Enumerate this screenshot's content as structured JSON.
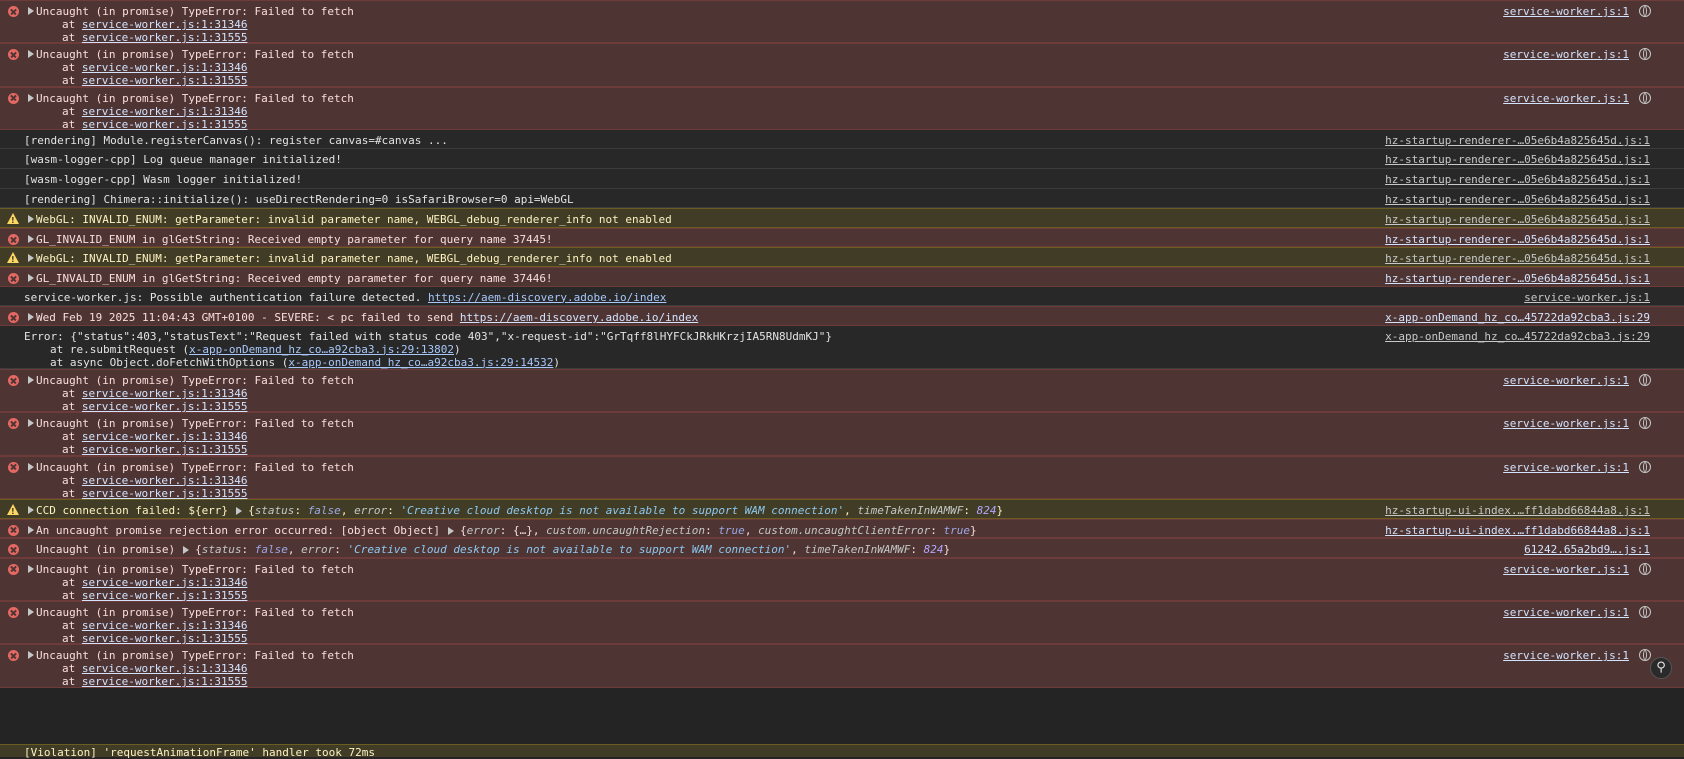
{
  "rows": [
    {
      "level": "error",
      "text": "Uncaught (in promise) TypeError: Failed to fetch",
      "stack": [
        "service-worker.js:1:31346",
        "service-worker.js:1:31555"
      ],
      "source": "service-worker.js:1"
    },
    {
      "level": "error",
      "text": "Uncaught (in promise) TypeError: Failed to fetch",
      "stack": [
        "service-worker.js:1:31346",
        "service-worker.js:1:31555"
      ],
      "source": "service-worker.js:1"
    },
    {
      "level": "error",
      "text": "Uncaught (in promise) TypeError: Failed to fetch",
      "stack": [
        "service-worker.js:1:31346",
        "service-worker.js:1:31555"
      ],
      "source": "service-worker.js:1"
    },
    {
      "level": "info",
      "text": "[rendering] Module.registerCanvas(): register canvas=#canvas ...",
      "source": "hz-startup-renderer-…05e6b4a825645d.js:1"
    },
    {
      "level": "info",
      "text": "[wasm-logger-cpp] Log queue manager initialized!",
      "source": "hz-startup-renderer-…05e6b4a825645d.js:1"
    },
    {
      "level": "info",
      "text": "[wasm-logger-cpp] Wasm logger initialized!",
      "source": "hz-startup-renderer-…05e6b4a825645d.js:1"
    },
    {
      "level": "info",
      "text": "[rendering] Chimera::initialize(): useDirectRendering=0 isSafariBrowser=0 api=WebGL",
      "source": "hz-startup-renderer-…05e6b4a825645d.js:1"
    },
    {
      "level": "warning",
      "text": "WebGL: INVALID_ENUM: getParameter: invalid parameter name, WEBGL_debug_renderer_info not enabled",
      "source": "hz-startup-renderer-…05e6b4a825645d.js:1"
    },
    {
      "level": "error",
      "text": "GL_INVALID_ENUM in glGetString: Received empty parameter for query name 37445!",
      "source": "hz-startup-renderer-…05e6b4a825645d.js:1"
    },
    {
      "level": "warning",
      "text": "WebGL: INVALID_ENUM: getParameter: invalid parameter name, WEBGL_debug_renderer_info not enabled",
      "source": "hz-startup-renderer-…05e6b4a825645d.js:1"
    },
    {
      "level": "error",
      "text": "GL_INVALID_ENUM in glGetString: Received empty parameter for query name 37446!",
      "source": "hz-startup-renderer-…05e6b4a825645d.js:1"
    },
    {
      "level": "info",
      "text": "service-worker.js: Possible authentication failure detected. ",
      "link": "https://aem-discovery.adobe.io/index",
      "source": "service-worker.js:1"
    },
    {
      "level": "error",
      "text": "Wed Feb 19 2025 11:04:43 GMT+0100 - SEVERE: < pc failed to send ",
      "link": "https://aem-discovery.adobe.io/index",
      "source": "x-app-onDemand_hz_co…45722da92cba3.js:29"
    },
    {
      "level": "info",
      "text": "Error: {\"status\":403,\"statusText\":\"Request failed with status code 403\",\"x-request-id\":\"GrTqff8lHYFCkJRkHKrzjIA5RN8UdmKJ\"}",
      "trace": [
        {
          "pre": "at re.submitRequest (",
          "link": "x-app-onDemand_hz_co…a92cba3.js:29:13802",
          "post": ")"
        },
        {
          "pre": "at async Object.doFetchWithOptions (",
          "link": "x-app-onDemand_hz_co…a92cba3.js:29:14532",
          "post": ")"
        }
      ],
      "source": "x-app-onDemand_hz_co…45722da92cba3.js:29"
    },
    {
      "level": "error",
      "text": "Uncaught (in promise) TypeError: Failed to fetch",
      "stack": [
        "service-worker.js:1:31346",
        "service-worker.js:1:31555"
      ],
      "source": "service-worker.js:1"
    },
    {
      "level": "error",
      "text": "Uncaught (in promise) TypeError: Failed to fetch",
      "stack": [
        "service-worker.js:1:31346",
        "service-worker.js:1:31555"
      ],
      "source": "service-worker.js:1"
    },
    {
      "level": "error",
      "text": "Uncaught (in promise) TypeError: Failed to fetch",
      "stack": [
        "service-worker.js:1:31346",
        "service-worker.js:1:31555"
      ],
      "source": "service-worker.js:1"
    },
    {
      "level": "warning",
      "text": "CCD connection failed: ${err}",
      "obj": [
        [
          "status",
          "false"
        ],
        [
          "error",
          "'Creative cloud desktop is not available to support WAM connection'"
        ],
        [
          "timeTakenInWAMWF",
          "824"
        ]
      ],
      "source": "hz-startup-ui-index.…ff1dabd66844a8.js:1"
    },
    {
      "level": "error",
      "text": "An uncaught promise rejection error occurred: [object Object]",
      "obj": [
        [
          "error",
          "{…}"
        ],
        [
          "custom.uncaughtRejection",
          "true"
        ],
        [
          "custom.uncaughtClientError",
          "true"
        ]
      ],
      "source": "hz-startup-ui-index.…ff1dabd66844a8.js:1"
    },
    {
      "level": "error",
      "text": "Uncaught (in promise)",
      "obj": [
        [
          "status",
          "false"
        ],
        [
          "error",
          "'Creative cloud desktop is not available to support WAM connection'"
        ],
        [
          "timeTakenInWAMWF",
          "824"
        ]
      ],
      "source": "61242.65a2bd9….js:1"
    },
    {
      "level": "error",
      "text": "Uncaught (in promise) TypeError: Failed to fetch",
      "stack": [
        "service-worker.js:1:31346",
        "service-worker.js:1:31555"
      ],
      "source": "service-worker.js:1"
    },
    {
      "level": "error",
      "text": "Uncaught (in promise) TypeError: Failed to fetch",
      "stack": [
        "service-worker.js:1:31346",
        "service-worker.js:1:31555"
      ],
      "source": "service-worker.js:1"
    },
    {
      "level": "error",
      "text": "Uncaught (in promise) TypeError: Failed to fetch",
      "stack": [
        "service-worker.js:1:31346",
        "service-worker.js:1:31555"
      ],
      "source": "service-worker.js:1"
    }
  ],
  "cut_text": "[Violation] 'requestAnimationFrame' handler took 72ms",
  "stack_prefix": "at "
}
